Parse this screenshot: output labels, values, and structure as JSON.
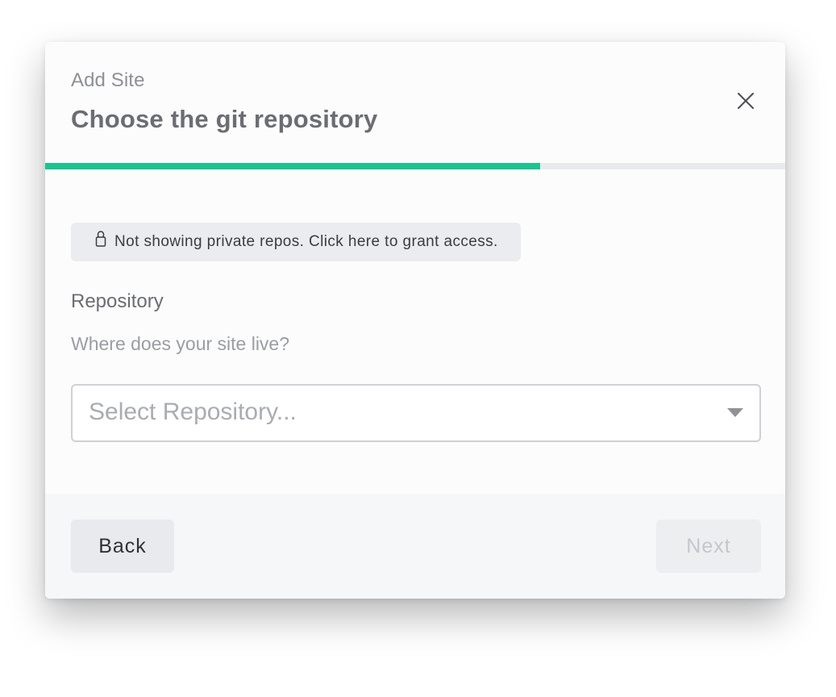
{
  "modal": {
    "eyebrow": "Add Site",
    "title": "Choose the git repository",
    "close_icon": "close-icon"
  },
  "progress": {
    "fraction": 0.669,
    "color": "#1cc38f",
    "track_color": "#e9eaed"
  },
  "private_notice": {
    "icon": "lock-icon",
    "text": "Not showing private repos. Click here to grant access."
  },
  "repository": {
    "label": "Repository",
    "help": "Where does your site live?",
    "placeholder": "Select Repository...",
    "caret_icon": "caret-down-icon"
  },
  "footer": {
    "back_label": "Back",
    "next_label": "Next",
    "next_enabled": false
  }
}
